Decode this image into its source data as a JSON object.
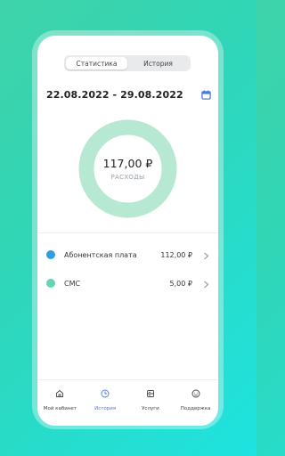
{
  "segmented": {
    "tabs": [
      {
        "label": "Статистика",
        "active": true
      },
      {
        "label": "История",
        "active": false
      }
    ]
  },
  "period": {
    "range": "22.08.2022 - 29.08.2022",
    "icon": "calendar-icon"
  },
  "summary": {
    "total": "117,00 ₽",
    "label": "РАСХОДЫ",
    "ring_color": "#b7e8d2"
  },
  "expenses": [
    {
      "label": "Абонентская плата",
      "value": "112,00 ₽",
      "color": "#2f9fdf"
    },
    {
      "label": "СМС",
      "value": "5,00 ₽",
      "color": "#63d4b4"
    }
  ],
  "tabbar": {
    "items": [
      {
        "label": "Мой кабинет",
        "icon": "home-icon",
        "active": false
      },
      {
        "label": "История",
        "icon": "clock-icon",
        "active": true
      },
      {
        "label": "Услуги",
        "icon": "services-icon",
        "active": false
      },
      {
        "label": "Поддержка",
        "icon": "support-icon",
        "active": false
      }
    ]
  },
  "colors": {
    "accent": "#4a7be0",
    "background_from": "#3fd3a8",
    "background_to": "#1ee3e0"
  }
}
